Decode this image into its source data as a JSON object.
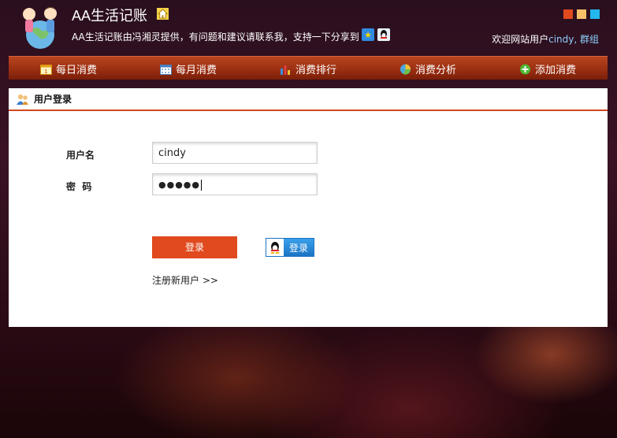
{
  "header": {
    "title": "AA生活记账",
    "subtitle": "AA生活记账由冯湘灵提供，有问题和建议请联系我，支持一下分享到",
    "welcome_prefix": "欢迎网站用户",
    "welcome_user": "cindy",
    "welcome_suffix": ", 群组",
    "swatches": [
      "#e04a1e",
      "#f6c06a",
      "#22b8ee"
    ]
  },
  "nav": {
    "items": [
      {
        "label": "每日消费",
        "icon": "calendar-day-icon"
      },
      {
        "label": "每月消费",
        "icon": "calendar-month-icon"
      },
      {
        "label": "消费排行",
        "icon": "bar-chart-icon"
      },
      {
        "label": "消费分析",
        "icon": "pie-chart-icon"
      },
      {
        "label": "添加消费",
        "icon": "add-icon"
      }
    ]
  },
  "panel": {
    "title": "用户登录"
  },
  "form": {
    "username_label": "用户名",
    "password_label": "密  码",
    "username_value": "cindy",
    "password_mask": "●●●●●",
    "login_button": "登录",
    "qq_login_button": "登录",
    "register_link": "注册新用户 >>"
  }
}
